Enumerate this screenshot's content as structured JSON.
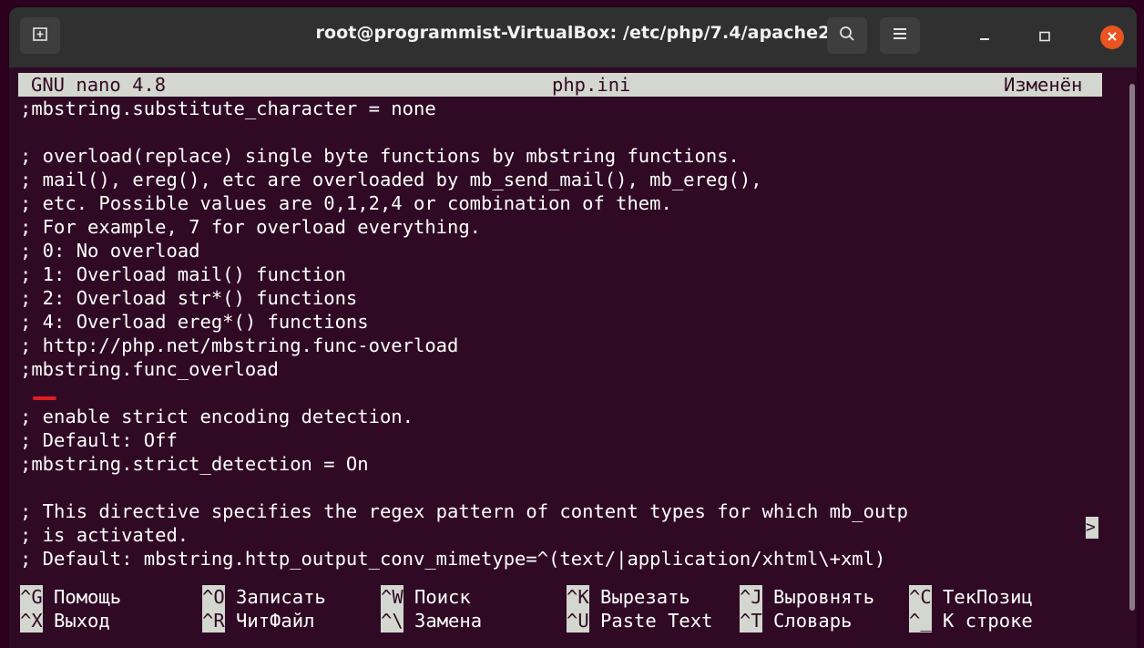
{
  "window": {
    "title": "root@programmist-VirtualBox: /etc/php/7.4/apache2",
    "new_tab_icon": "new-tab-icon",
    "search_icon": "search-icon",
    "menu_icon": "hamburger-menu-icon",
    "minimize_icon": "minimize-icon",
    "maximize_icon": "maximize-icon",
    "close_icon": "close-icon",
    "close_color": "#e95420"
  },
  "nano": {
    "version": "GNU nano 4.8",
    "filename": "php.ini",
    "status": "Изменён",
    "header_bg": "#d3d7cf",
    "bg": "#300a24",
    "lines": [
      ";mbstring.substitute_character = none",
      "",
      "; overload(replace) single byte functions by mbstring functions.",
      "; mail(), ereg(), etc are overloaded by mb_send_mail(), mb_ereg(),",
      "; etc. Possible values are 0,1,2,4 or combination of them.",
      "; For example, 7 for overload everything.",
      "; 0: No overload",
      "; 1: Overload mail() function",
      "; 2: Overload str*() functions",
      "; 4: Overload ereg*() functions",
      "; http://php.net/mbstring.func-overload",
      ";mbstring.func_overload",
      "",
      "; enable strict encoding detection.",
      "; Default: Off",
      ";mbstring.strict_detection = On",
      "",
      "; This directive specifies the regex pattern of content types for which mb_outp",
      "; is activated.",
      "; Default: mbstring.http_output_conv_mimetype=^(text/|application/xhtml\\+xml)"
    ],
    "more_marker": ">",
    "shortcuts_row1": [
      {
        "key": "^G",
        "label": "Помощь"
      },
      {
        "key": "^O",
        "label": "Записать"
      },
      {
        "key": "^W",
        "label": "Поиск"
      },
      {
        "key": "^K",
        "label": "Вырезать"
      },
      {
        "key": "^J",
        "label": "Выровнять"
      },
      {
        "key": "^C",
        "label": "ТекПозиц"
      }
    ],
    "shortcuts_row2": [
      {
        "key": "^X",
        "label": "Выход"
      },
      {
        "key": "^R",
        "label": "ЧитФайл"
      },
      {
        "key": "^\\",
        "label": "Замена"
      },
      {
        "key": "^U",
        "label": "Paste Text"
      },
      {
        "key": "^T",
        "label": "Словарь"
      },
      {
        "key": "^_",
        "label": "К строке"
      }
    ]
  }
}
